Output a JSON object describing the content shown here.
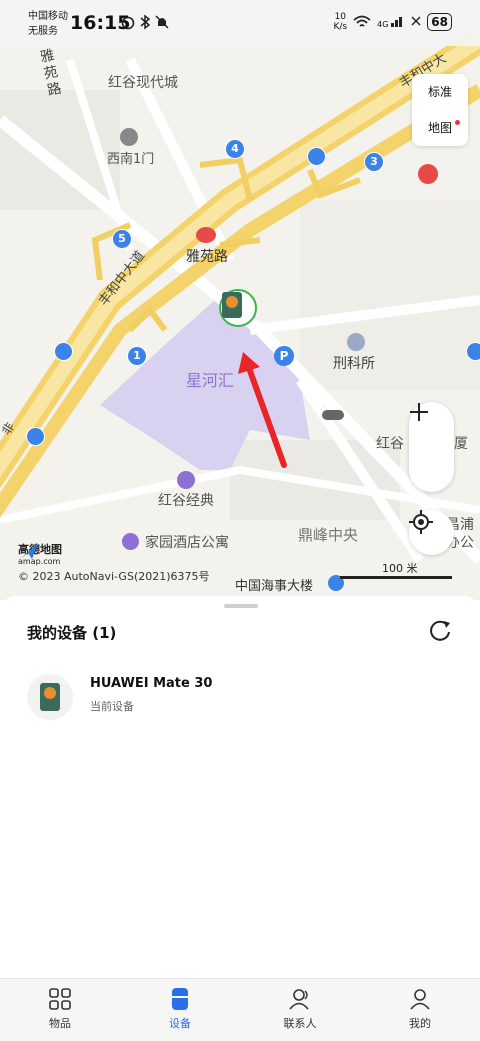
{
  "status_bar": {
    "carrier_line1": "中国移动",
    "carrier_line2": "无服务",
    "time": "16:15",
    "net_speed_value": "10",
    "net_speed_unit": "K/s",
    "signal_label": "4G",
    "battery": "68"
  },
  "map": {
    "type_switch": {
      "standard": "标准",
      "map": "地图"
    },
    "pois": {
      "honggu_modern_city": "红谷现代城",
      "ximen_gate1": "西南1门",
      "yayuan_road": "雅苑路",
      "xinghe_hui": "星河汇",
      "criminal_institute": "刑科所",
      "honggu_jingdian": "红谷经典",
      "jiayuan_hotel": "家园酒店公寓",
      "dingfeng_zhongyang": "鼎峰中央",
      "china_maritime_tower": "中国海事大楼",
      "honggu_partial": "红谷",
      "xia_partial": "厦",
      "changpu_partial": "昌浦",
      "office_partial": "办公",
      "yayuan_road_vertical": "雅苑路",
      "fenghe_road": "丰和中大道",
      "fenghe_road_top": "丰和中大",
      "left_edge_char": "非"
    },
    "route_badges": [
      "4",
      "3",
      "5",
      "1"
    ],
    "scale_label": "100 米",
    "logo_cn": "高德地图",
    "logo_en": "amap.com",
    "copyright": "© 2023 AutoNavi-GS(2021)6375号"
  },
  "sheet": {
    "title": "我的设备 (1)",
    "device": {
      "name": "HUAWEI Mate 30",
      "subtitle": "当前设备"
    }
  },
  "tabbar": {
    "tabs": [
      {
        "label": "物品",
        "icon": "grid-icon",
        "active": false
      },
      {
        "label": "设备",
        "icon": "device-icon",
        "active": true
      },
      {
        "label": "联系人",
        "icon": "contacts-icon",
        "active": false
      },
      {
        "label": "我的",
        "icon": "profile-icon",
        "active": false
      }
    ]
  },
  "colors": {
    "accent": "#2a6ee8",
    "route_badge": "#3b83e8",
    "highlight_area": "#d9d1f0",
    "arrow": "#e8262a",
    "marker_ring": "#39b54a"
  }
}
